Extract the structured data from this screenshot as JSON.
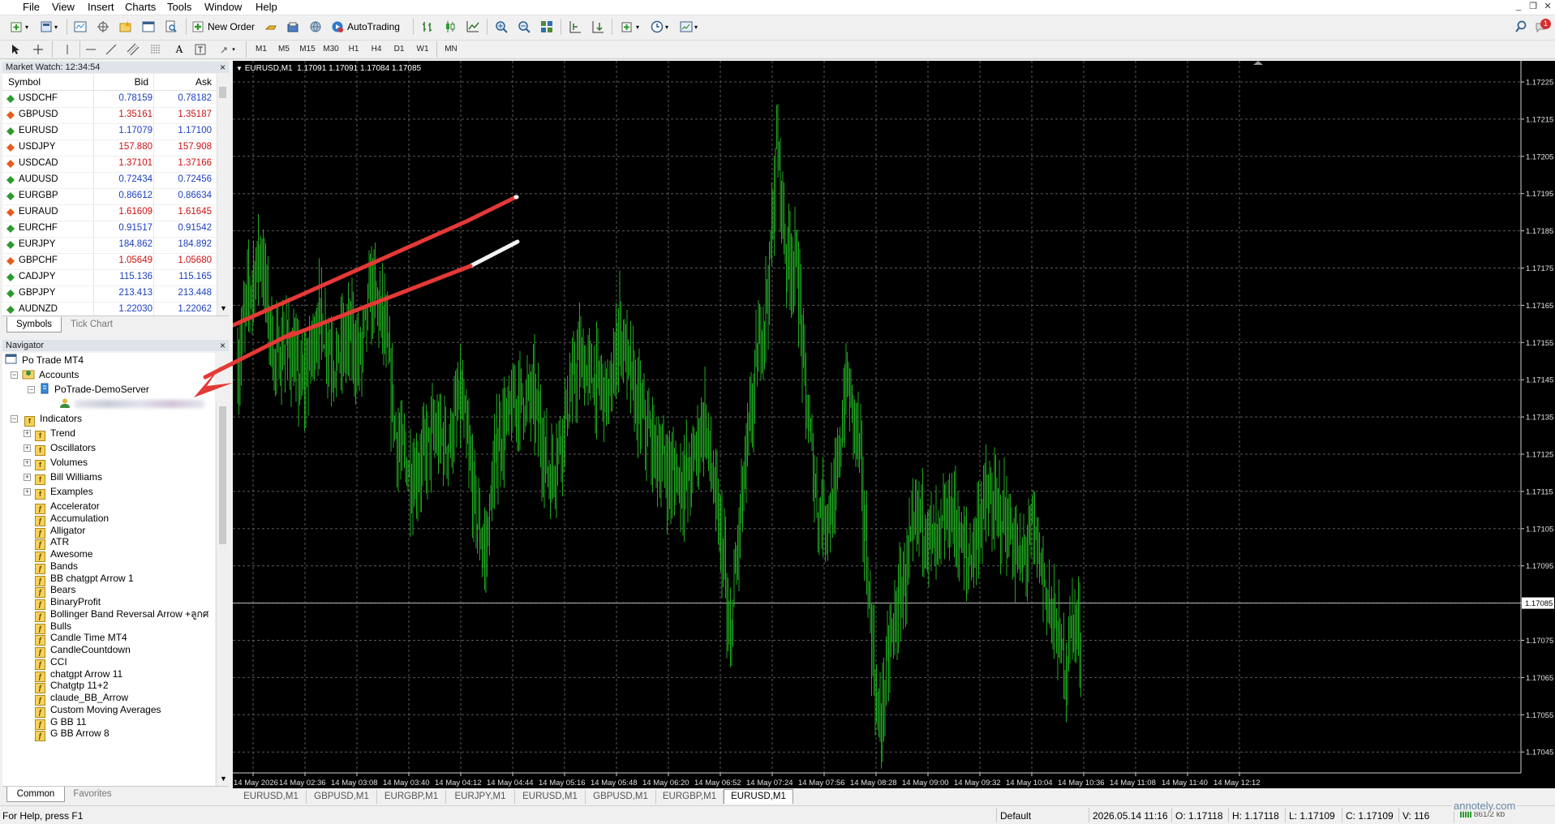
{
  "menu": [
    "File",
    "View",
    "Insert",
    "Charts",
    "Tools",
    "Window",
    "Help"
  ],
  "toolbar": {
    "new_order_label": "New Order",
    "autotrading_label": "AutoTrading",
    "timeframes": [
      "M1",
      "M5",
      "M15",
      "M30",
      "H1",
      "H4",
      "D1",
      "W1",
      "MN"
    ],
    "notification_count": "1"
  },
  "market_watch": {
    "title": "Market Watch: 12:34:54",
    "columns": [
      "Symbol",
      "Bid",
      "Ask"
    ],
    "rows": [
      {
        "symbol": "USDCHF",
        "bid": "0.78159",
        "ask": "0.78182",
        "dir": "up"
      },
      {
        "symbol": "GBPUSD",
        "bid": "1.35161",
        "ask": "1.35187",
        "dir": "down"
      },
      {
        "symbol": "EURUSD",
        "bid": "1.17079",
        "ask": "1.17100",
        "dir": "up"
      },
      {
        "symbol": "USDJPY",
        "bid": "157.880",
        "ask": "157.908",
        "dir": "down"
      },
      {
        "symbol": "USDCAD",
        "bid": "1.37101",
        "ask": "1.37166",
        "dir": "down"
      },
      {
        "symbol": "AUDUSD",
        "bid": "0.72434",
        "ask": "0.72456",
        "dir": "up"
      },
      {
        "symbol": "EURGBP",
        "bid": "0.86612",
        "ask": "0.86634",
        "dir": "up"
      },
      {
        "symbol": "EURAUD",
        "bid": "1.61609",
        "ask": "1.61645",
        "dir": "down"
      },
      {
        "symbol": "EURCHF",
        "bid": "0.91517",
        "ask": "0.91542",
        "dir": "up"
      },
      {
        "symbol": "EURJPY",
        "bid": "184.862",
        "ask": "184.892",
        "dir": "up"
      },
      {
        "symbol": "GBPCHF",
        "bid": "1.05649",
        "ask": "1.05680",
        "dir": "down"
      },
      {
        "symbol": "CADJPY",
        "bid": "115.136",
        "ask": "115.165",
        "dir": "up"
      },
      {
        "symbol": "GBPJPY",
        "bid": "213.413",
        "ask": "213.448",
        "dir": "up"
      },
      {
        "symbol": "AUDNZD",
        "bid": "1.22030",
        "ask": "1.22062",
        "dir": "up"
      }
    ],
    "tabs": [
      "Symbols",
      "Tick Chart"
    ]
  },
  "navigator": {
    "title": "Navigator",
    "root": "Po Trade MT4",
    "accounts_label": "Accounts",
    "server": "PoTrade-DemoServer",
    "indicators_label": "Indicators",
    "folders": [
      "Trend",
      "Oscillators",
      "Volumes",
      "Bill Williams",
      "Examples"
    ],
    "items": [
      "Accelerator",
      "Accumulation",
      "Alligator",
      "ATR",
      "Awesome",
      "Bands",
      "BB chatgpt Arrow 1",
      "Bears",
      "BinaryProfit",
      "Bollinger Band Reversal Arrow +ลูกศ",
      "Bulls",
      "Candle Time MT4",
      "CandleCountdown",
      "CCI",
      "chatgpt  Arrow 11",
      "Chatgtp 11+2",
      "claude_BB_Arrow",
      "Custom Moving Averages",
      "G BB 11",
      "G BB Arrow 8"
    ],
    "tabs": [
      "Common",
      "Favorites"
    ]
  },
  "chart": {
    "header": "EURUSD,M1  1.17091 1.17091 1.17084 1.17085",
    "current_price": "1.17085",
    "price_labels": [
      "1.17225",
      "1.17215",
      "1.17205",
      "1.17195",
      "1.17185",
      "1.17175",
      "1.17165",
      "1.17155",
      "1.17145",
      "1.17135",
      "1.17125",
      "1.17115",
      "1.17105",
      "1.17095",
      "1.17085",
      "1.17075",
      "1.17065",
      "1.17055",
      "1.17045"
    ],
    "time_labels": [
      "14 May 2026",
      "14 May 02:36",
      "14 May 03:08",
      "14 May 03:40",
      "14 May 04:12",
      "14 May 04:44",
      "14 May 05:16",
      "14 May 05:48",
      "14 May 06:20",
      "14 May 06:52",
      "14 May 07:24",
      "14 May 07:56",
      "14 May 08:28",
      "14 May 09:00",
      "14 May 09:32",
      "14 May 10:04",
      "14 May 10:36",
      "14 May 11:08",
      "14 May 11:40",
      "14 May 12:12"
    ],
    "candle_color": "#1fa81f",
    "grid_color": "#5a5a5a",
    "arrow_color": "#e53935"
  },
  "chart_tabs": [
    "EURUSD,M1",
    "GBPUSD,M1",
    "EURGBP,M1",
    "EURJPY,M1",
    "EURUSD,M1",
    "GBPUSD,M1",
    "EURGBP,M1",
    "EURUSD,M1"
  ],
  "status": {
    "help": "For Help, press F1",
    "profile": "Default",
    "datetime": "2026.05.14 11:16",
    "open": "O: 1.17118",
    "high": "H: 1.17118",
    "low": "L: 1.17109",
    "close": "C: 1.17109",
    "volume": "V: 116",
    "traffic": "861/2 kb",
    "watermark": "annotely.com"
  }
}
